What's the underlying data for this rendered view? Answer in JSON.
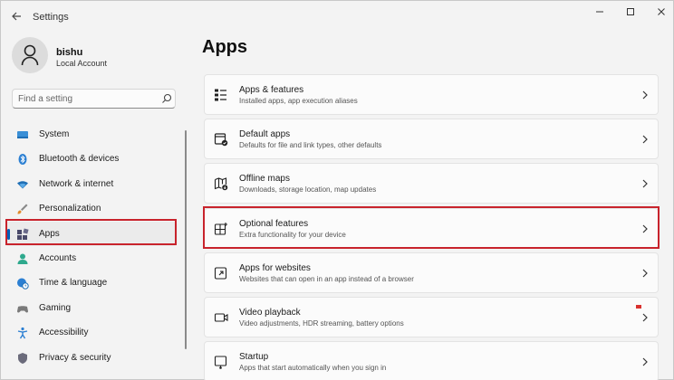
{
  "window": {
    "title": "Settings"
  },
  "profile": {
    "name": "bishu",
    "account_type": "Local Account"
  },
  "search": {
    "placeholder": "Find a setting"
  },
  "sidebar": {
    "items": [
      {
        "label": "System",
        "icon": "monitor-icon"
      },
      {
        "label": "Bluetooth & devices",
        "icon": "bluetooth-icon"
      },
      {
        "label": "Network & internet",
        "icon": "wifi-icon"
      },
      {
        "label": "Personalization",
        "icon": "brush-icon"
      },
      {
        "label": "Apps",
        "icon": "apps-icon",
        "selected": true
      },
      {
        "label": "Accounts",
        "icon": "person-icon"
      },
      {
        "label": "Time & language",
        "icon": "globe-clock-icon"
      },
      {
        "label": "Gaming",
        "icon": "controller-icon"
      },
      {
        "label": "Accessibility",
        "icon": "accessibility-icon"
      },
      {
        "label": "Privacy & security",
        "icon": "shield-icon"
      }
    ]
  },
  "main": {
    "title": "Apps",
    "cards": [
      {
        "title": "Apps & features",
        "description": "Installed apps, app execution aliases",
        "icon": "list-icon"
      },
      {
        "title": "Default apps",
        "description": "Defaults for file and link types, other defaults",
        "icon": "default-apps-icon"
      },
      {
        "title": "Offline maps",
        "description": "Downloads, storage location, map updates",
        "icon": "map-download-icon"
      },
      {
        "title": "Optional features",
        "description": "Extra functionality for your device",
        "icon": "grid-plus-icon",
        "highlighted": true
      },
      {
        "title": "Apps for websites",
        "description": "Websites that can open in an app instead of a browser",
        "icon": "app-link-icon"
      },
      {
        "title": "Video playback",
        "description": "Video adjustments, HDR streaming, battery options",
        "icon": "video-icon"
      },
      {
        "title": "Startup",
        "description": "Apps that start automatically when you sign in",
        "icon": "startup-icon"
      }
    ]
  },
  "colors": {
    "accent": "#005fb8",
    "highlight_border": "#c8232c"
  }
}
